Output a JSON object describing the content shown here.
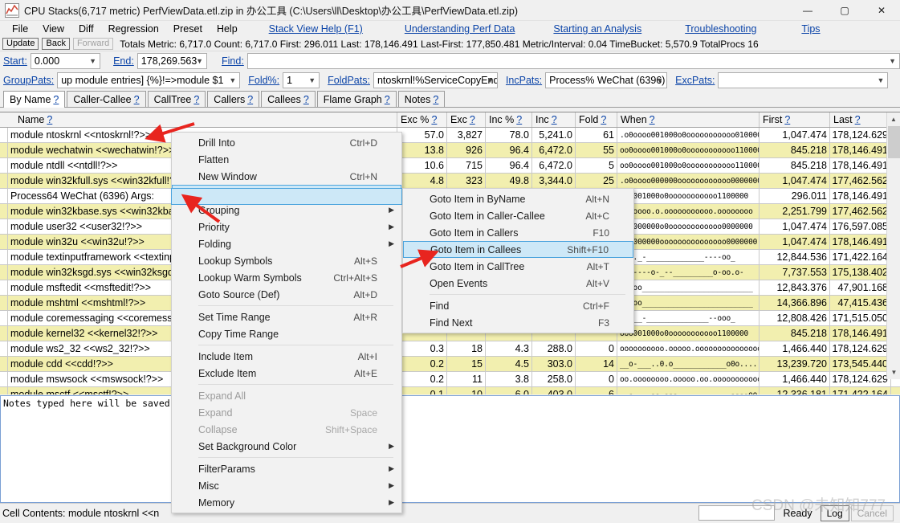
{
  "window": {
    "title": "CPU Stacks(6,717 metric) PerfViewData.etl.zip in 办公工具 (C:\\Users\\ll\\Desktop\\办公工具\\PerfViewData.etl.zip)",
    "icon": "chart-icon",
    "minimize": "—",
    "maximize": "▢",
    "close": "✕"
  },
  "menubar": {
    "items": [
      "File",
      "View",
      "Diff",
      "Regression",
      "Preset",
      "Help"
    ],
    "links": [
      "Stack View Help (F1)",
      "Understanding Perf Data",
      "Starting an Analysis",
      "Troubleshooting",
      "Tips"
    ]
  },
  "toolbar": {
    "update": "Update",
    "back": "Back",
    "forward": "Forward",
    "totals": "Totals Metric: 6,717.0  Count: 6,717.0  First: 296.011  Last: 178,146.491  Last-First: 177,850.481  Metric/Interval: 0.04  TimeBucket: 5,570.9  TotalProcs 16"
  },
  "filters": {
    "start_label": "Start:",
    "start_value": "0.000",
    "end_label": "End:",
    "end_value": "178,269.563",
    "find_label": "Find:",
    "find_value": "",
    "grouppats_label": "GroupPats:",
    "grouppats_value": "up module entries]  {%}!=>module $1",
    "foldpct_label": "Fold%:",
    "foldpct_value": "1",
    "foldpats_label": "FoldPats:",
    "foldpats_value": "ntoskrnl!%ServiceCopyEnd",
    "incpats_label": "IncPats:",
    "incpats_value": "Process% WeChat (6396)",
    "excpats_label": "ExcPats:",
    "excpats_value": ""
  },
  "tabs": [
    {
      "label": "By Name",
      "active": true
    },
    {
      "label": "Caller-Callee",
      "active": false
    },
    {
      "label": "CallTree",
      "active": false
    },
    {
      "label": "Callers",
      "active": false
    },
    {
      "label": "Callees",
      "active": false
    },
    {
      "label": "Flame Graph",
      "active": false
    },
    {
      "label": "Notes",
      "active": false
    }
  ],
  "grid": {
    "columns": [
      "Name",
      "Exc %",
      "Exc",
      "Inc %",
      "Inc",
      "Fold",
      "When",
      "First",
      "Last"
    ],
    "rows": [
      {
        "name": "module ntoskrnl <<ntoskrnl!?>>",
        "exc_pct": "57.0",
        "exc": "3,827",
        "inc_pct": "78.0",
        "inc": "5,241.0",
        "fold": "61",
        "when": ".o0oooo001000o0ooooooooooo0100000",
        "first": "1,047.474",
        "last": "178,124.629",
        "alt": false
      },
      {
        "name": "module wechatwin <<wechatwin!?>>",
        "exc_pct": "13.8",
        "exc": "926",
        "inc_pct": "96.4",
        "inc": "6,472.0",
        "fold": "55",
        "when": "oo0oooo001000o0ooooooooooo1100000",
        "first": "845.218",
        "last": "178,146.491",
        "alt": true
      },
      {
        "name": "module ntdll <<ntdll!?>>",
        "exc_pct": "10.6",
        "exc": "715",
        "inc_pct": "96.4",
        "inc": "6,472.0",
        "fold": "5",
        "when": "oo0oooo001000o0ooooooooooo1100000",
        "first": "845.218",
        "last": "178,146.491",
        "alt": false
      },
      {
        "name": "module win32kfull.sys <<win32kfull!?>>",
        "exc_pct": "4.8",
        "exc": "323",
        "inc_pct": "49.8",
        "inc": "3,344.0",
        "fold": "25",
        "when": ".o0oooo000000oooooooooooo00000000",
        "first": "1,047.474",
        "last": "177,462.562",
        "alt": true
      },
      {
        "name": "Process64 WeChat (6396) Args:",
        "exc_pct": "",
        "exc": "",
        "inc_pct": "",
        "inc": "",
        "fold": "",
        "when": "ooo001000o0ooooooooooo1100000",
        "first": "296.011",
        "last": "178,146.491",
        "alt": false
      },
      {
        "name": "module win32kbase.sys <<win32kbase!?>>",
        "exc_pct": "",
        "exc": "",
        "inc_pct": "",
        "inc": "",
        "fold": "",
        "when": "ooooooo.o.ooooooooooo.oooooooo",
        "first": "2,251.799",
        "last": "177,462.562",
        "alt": true
      },
      {
        "name": "module user32 <<user32!?>>",
        "exc_pct": "",
        "exc": "",
        "inc_pct": "",
        "inc": "",
        "fold": "",
        "when": "ooo000000o0oooooooooooo0000000",
        "first": "1,047.474",
        "last": "176,597.085",
        "alt": false
      },
      {
        "name": "module win32u <<win32u!?>>",
        "exc_pct": "",
        "exc": "",
        "inc_pct": "",
        "inc": "",
        "fold": "",
        "when": "ooo000000ooooooooooooooo0000000",
        "first": "1,047.474",
        "last": "178,146.491",
        "alt": true
      },
      {
        "name": "module textinputframework <<textinputframework!?>>",
        "exc_pct": "",
        "exc": "",
        "inc_pct": "",
        "inc": "",
        "fold": "",
        "when": "__.._-_____________----oo_",
        "first": "12,844.536",
        "last": "171,422.164",
        "alt": false
      },
      {
        "name": "module win32ksgd.sys <<win32ksgd!?>>",
        "exc_pct": "",
        "exc": "",
        "inc_pct": "",
        "inc": "",
        "fold": "",
        "when": "-_-----o-_--_________o-oo.o-",
        "first": "7,737.553",
        "last": "175,138.402",
        "alt": true
      },
      {
        "name": "module msftedit <<msftedit!?>>",
        "exc_pct": "",
        "exc": "",
        "inc_pct": "",
        "inc": "",
        "fold": "",
        "when": "___oo_________________________",
        "first": "12,843.376",
        "last": "47,901.168",
        "alt": false
      },
      {
        "name": "module mshtml <<mshtml!?>>",
        "exc_pct": "",
        "exc": "",
        "inc_pct": "",
        "inc": "",
        "fold": "",
        "when": "___oo_________________________",
        "first": "14,366.896",
        "last": "47,415.436",
        "alt": true
      },
      {
        "name": "module coremessaging <<coremessaging!?>>",
        "exc_pct": "",
        "exc": "",
        "inc_pct": "",
        "inc": "",
        "fold": "",
        "when": "__.__-______________--ooo_",
        "first": "12,808.426",
        "last": "171,515.050",
        "alt": false
      },
      {
        "name": "module kernel32 <<kernel32!?>>",
        "exc_pct": "",
        "exc": "",
        "inc_pct": "",
        "inc": "",
        "fold": "",
        "when": "ooo001000o0ooooooooooo1100000",
        "first": "845.218",
        "last": "178,146.491",
        "alt": true
      },
      {
        "name": "module ws2_32 <<ws2_32!?>>",
        "exc_pct": "0.3",
        "exc": "18",
        "inc_pct": "4.3",
        "inc": "288.0",
        "fold": "0",
        "when": "oooooooooo.ooooo.oooooooooooooooo",
        "first": "1,466.440",
        "last": "178,124.629",
        "alt": false
      },
      {
        "name": "module cdd <<cdd!?>>",
        "exc_pct": "0.2",
        "exc": "15",
        "inc_pct": "4.5",
        "inc": "303.0",
        "fold": "14",
        "when": "__o-___..0.o____________o0o....",
        "first": "13,239.720",
        "last": "173,545.440",
        "alt": true
      },
      {
        "name": "module mswsock <<mswsock!?>>",
        "exc_pct": "0.2",
        "exc": "11",
        "inc_pct": "3.8",
        "inc": "258.0",
        "fold": "0",
        "when": "oo.oooooooo.ooooo.oo.ooooooooooooo",
        "first": "1,466.440",
        "last": "178,124.629",
        "alt": false
      },
      {
        "name": "module msctf <<msctf!?>>",
        "exc_pct": "0.1",
        "exc": "10",
        "inc_pct": "6.0",
        "inc": "403.0",
        "fold": "6",
        "when": "__-____--_---____________----oo_",
        "first": "12,336.181",
        "last": "171,422.164",
        "alt": true
      }
    ]
  },
  "context_menu": {
    "items": [
      {
        "label": "Drill Into",
        "shortcut": "Ctrl+D",
        "submenu": false,
        "disabled": false,
        "selected": false
      },
      {
        "label": "Flatten",
        "shortcut": "",
        "submenu": false,
        "disabled": false,
        "selected": false
      },
      {
        "label": "New Window",
        "shortcut": "Ctrl+N",
        "submenu": false,
        "disabled": false,
        "selected": false
      },
      {
        "label": "Goto",
        "shortcut": "",
        "submenu": true,
        "disabled": false,
        "selected": true
      },
      {
        "label": "Grouping",
        "shortcut": "",
        "submenu": true,
        "disabled": false,
        "selected": false
      },
      {
        "label": "Priority",
        "shortcut": "",
        "submenu": true,
        "disabled": false,
        "selected": false
      },
      {
        "label": "Folding",
        "shortcut": "",
        "submenu": true,
        "disabled": false,
        "selected": false
      },
      {
        "label": "Lookup Symbols",
        "shortcut": "Alt+S",
        "submenu": false,
        "disabled": false,
        "selected": false
      },
      {
        "label": "Lookup Warm Symbols",
        "shortcut": "Ctrl+Alt+S",
        "submenu": false,
        "disabled": false,
        "selected": false
      },
      {
        "label": "Goto Source (Def)",
        "shortcut": "Alt+D",
        "submenu": false,
        "disabled": false,
        "selected": false
      },
      {
        "separator": true
      },
      {
        "label": "Set Time Range",
        "shortcut": "Alt+R",
        "submenu": false,
        "disabled": false,
        "selected": false
      },
      {
        "label": "Copy Time Range",
        "shortcut": "",
        "submenu": false,
        "disabled": false,
        "selected": false
      },
      {
        "separator": true
      },
      {
        "label": "Include Item",
        "shortcut": "Alt+I",
        "submenu": false,
        "disabled": false,
        "selected": false
      },
      {
        "label": "Exclude Item",
        "shortcut": "Alt+E",
        "submenu": false,
        "disabled": false,
        "selected": false
      },
      {
        "separator": true
      },
      {
        "label": "Expand All",
        "shortcut": "",
        "submenu": false,
        "disabled": true,
        "selected": false
      },
      {
        "label": "Expand",
        "shortcut": "Space",
        "submenu": false,
        "disabled": true,
        "selected": false
      },
      {
        "label": "Collapse",
        "shortcut": "Shift+Space",
        "submenu": false,
        "disabled": true,
        "selected": false
      },
      {
        "label": "Set Background Color",
        "shortcut": "",
        "submenu": true,
        "disabled": false,
        "selected": false
      },
      {
        "separator": true
      },
      {
        "label": "FilterParams",
        "shortcut": "",
        "submenu": true,
        "disabled": false,
        "selected": false
      },
      {
        "label": "Misc",
        "shortcut": "",
        "submenu": true,
        "disabled": false,
        "selected": false
      },
      {
        "label": "Memory",
        "shortcut": "",
        "submenu": true,
        "disabled": false,
        "selected": false
      }
    ]
  },
  "goto_submenu": {
    "items": [
      {
        "label": "Goto Item in ByName",
        "shortcut": "Alt+N",
        "selected": false
      },
      {
        "label": "Goto Item in Caller-Callee",
        "shortcut": "Alt+C",
        "selected": false
      },
      {
        "label": "Goto Item in Callers",
        "shortcut": "F10",
        "selected": false
      },
      {
        "label": "Goto Item in Callees",
        "shortcut": "Shift+F10",
        "selected": true
      },
      {
        "label": "Goto Item in CallTree",
        "shortcut": "Alt+T",
        "selected": false
      },
      {
        "label": "Open Events",
        "shortcut": "Alt+V",
        "selected": false
      },
      {
        "separator": true
      },
      {
        "label": "Find",
        "shortcut": "Ctrl+F",
        "selected": false
      },
      {
        "label": "Find Next",
        "shortcut": "F3",
        "selected": false
      }
    ]
  },
  "notes": {
    "placeholder_text": "Notes typed here will be saved"
  },
  "statusbar": {
    "cell_contents": "Cell Contents: module ntoskrnl <<n",
    "ready": "Ready",
    "log": "Log",
    "cancel": "Cancel",
    "input_value": ""
  },
  "watermark": "CSDN @未知知777",
  "colors": {
    "link": "#0b44a8",
    "row_alt": "#f2efaf",
    "menu_select": "#cde8f7",
    "menu_select_border": "#4aa3dd",
    "arrow_red": "#e8251f"
  }
}
